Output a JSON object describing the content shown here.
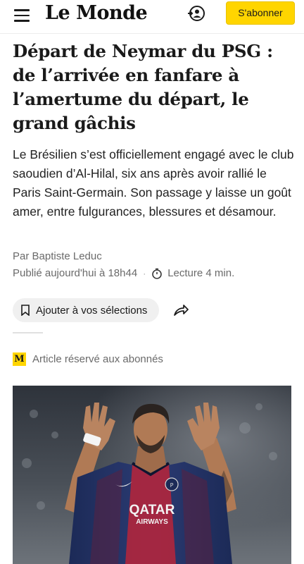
{
  "header": {
    "logo": "Le Monde",
    "subscribe_label": "S'abonner"
  },
  "article": {
    "title": "Départ de Neymar du PSG : de l’arrivée en fanfare à l’amertume du départ, le grand gâchis",
    "standfirst": "Le Brésilien s’est officiellement engagé avec le club saoudien d’Al-Hilal, six ans après avoir rallié le Paris Saint-Germain. Son passage y laisse un goût amer, entre fulgurances, blessures et désamour.",
    "byline": "Par Baptiste Leduc",
    "published": "Publié aujourd'hui à 18h44",
    "separator": "·",
    "reading_time": "Lecture 4 min.",
    "save_label": "Ajouter à vos sélections",
    "premium_icon": "M",
    "premium_label": "Article réservé aux abonnés",
    "photo": {
      "jersey_brand": "QATAR",
      "jersey_brand_sub": "AIRWAYS"
    }
  },
  "colors": {
    "accent": "#ffd500",
    "jersey": "#1d2b5a",
    "jersey_red": "#b8243a"
  },
  "icons": {
    "menu": "hamburger-icon",
    "account": "account-icon",
    "clock": "clock-icon",
    "bookmark": "bookmark-icon",
    "share": "share-icon"
  }
}
